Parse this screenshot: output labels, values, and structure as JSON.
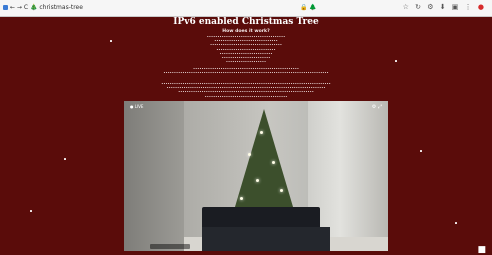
{
  "browser": {
    "tab_title": "← → C  🎄 christmas-tree",
    "address": "🔒 🌲",
    "toolbar_icons": "☆ ↻ ⚙ ⬇ ▣ ⋮",
    "toolbar_icon_red": "●"
  },
  "page": {
    "title": "IPv6 enabled Christmas Tree",
    "heading": "How does it work?",
    "lines1": [
      "•••••••••••••••••••••••••••••••••••••",
      "••••••••••••••••••••••••••••••",
      "••••••••••••••••••••••••••••••••••",
      "••••••••••••••••••••••••••••",
      "•••••••••••••••••••••••••",
      "•••••••••••••••••••••••",
      "•••••••••••••••••••",
      "••••••••••••••••••••••••••••••••••••••••"
    ],
    "lines2": [
      "••••••••••••••••••••••••••••••••••••••••••••••••••",
      "••••••••••••••••••••••••••••••••••••••••••••••••••••••••••••••••••••••••••••••"
    ],
    "lines3": [
      "••••••••••••••••••••••••••••••••••••••••••••••••••••••••••••••••••••••••••••••••",
      "•••••••••••••••••••••••••••••••••••••••••••••••••••••••••••••••••••••••••••",
      "••••••••••••••••••••••••••••••••••••••••••••••••••••••••••••••••",
      "•••••••••••••••••••••••••••••••••••••••"
    ]
  },
  "video": {
    "top_left_label": "● LIVE",
    "top_right_icons": "⚙ ⤢"
  },
  "corner_text": "■"
}
